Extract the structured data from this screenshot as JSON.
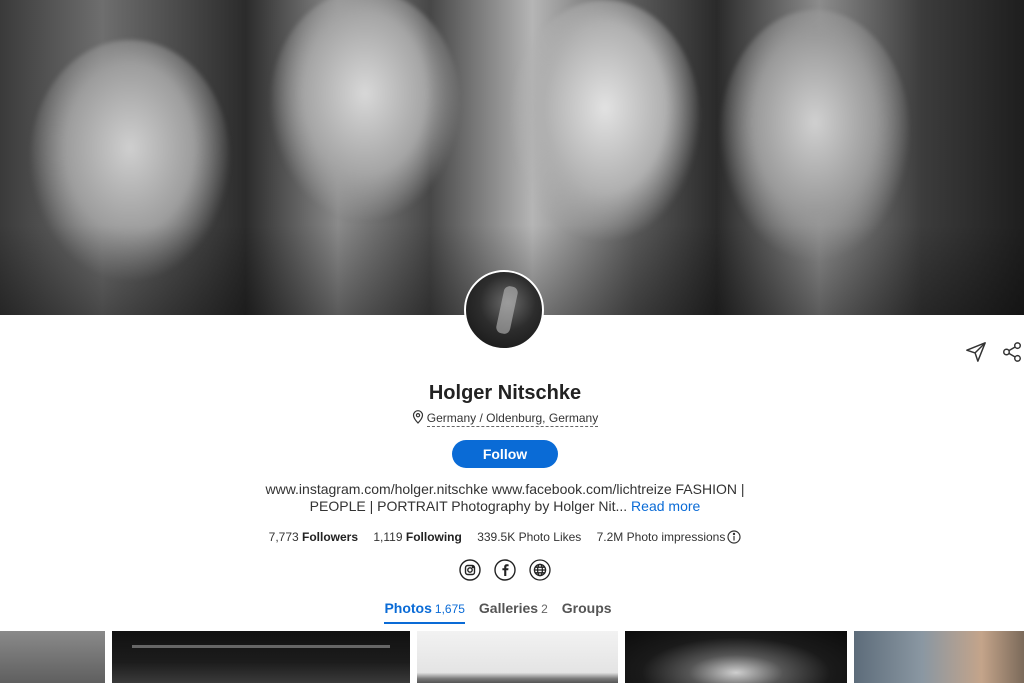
{
  "profile": {
    "name": "Holger Nitschke",
    "location": "Germany / Oldenburg, Germany",
    "follow_label": "Follow",
    "bio": "www.instagram.com/holger.nitschke www.facebook.com/lichtreize FASHION | PEOPLE | PORTRAIT Photography by Holger Nit...",
    "read_more": "Read more"
  },
  "stats": {
    "followers_value": "7,773",
    "followers_label": "Followers",
    "following_value": "1,119",
    "following_label": "Following",
    "photo_likes": "339.5K Photo Likes",
    "photo_impressions": "7.2M Photo impressions"
  },
  "socials": [
    "instagram-icon",
    "facebook-icon",
    "website-icon"
  ],
  "tabs": [
    {
      "label": "Photos",
      "count": "1,675",
      "active": true
    },
    {
      "label": "Galleries",
      "count": "2",
      "active": false
    },
    {
      "label": "Groups",
      "count": "",
      "active": false
    }
  ],
  "colors": {
    "accent": "#0a6bd6",
    "text": "#222222"
  }
}
